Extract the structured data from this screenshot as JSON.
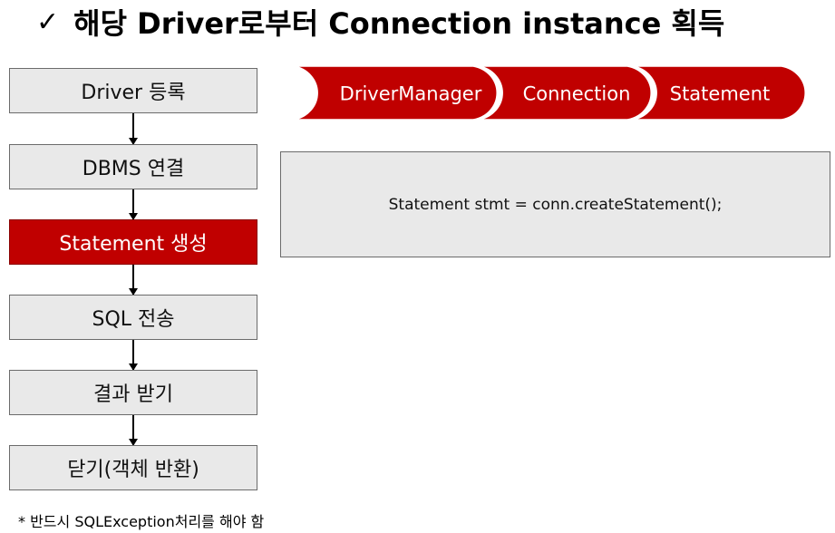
{
  "title": {
    "check_glyph": "✓",
    "text": "해당 Driver로부터 Connection instance 획득"
  },
  "steps": [
    {
      "label": "Driver 등록",
      "active": false
    },
    {
      "label": "DBMS 연결",
      "active": false
    },
    {
      "label": "Statement 생성",
      "active": true
    },
    {
      "label": "SQL 전송",
      "active": false
    },
    {
      "label": "결과 받기",
      "active": false
    },
    {
      "label": "닫기(객체 반환)",
      "active": false
    }
  ],
  "chain": [
    "DriverManager",
    "Connection",
    "Statement"
  ],
  "code": "Statement stmt = conn.createStatement();",
  "note": "* 반드시 SQLException처리를 해야 함",
  "colors": {
    "accent": "#c00000",
    "box_fill": "#e9e9e9",
    "box_border": "#6b6b6b"
  }
}
